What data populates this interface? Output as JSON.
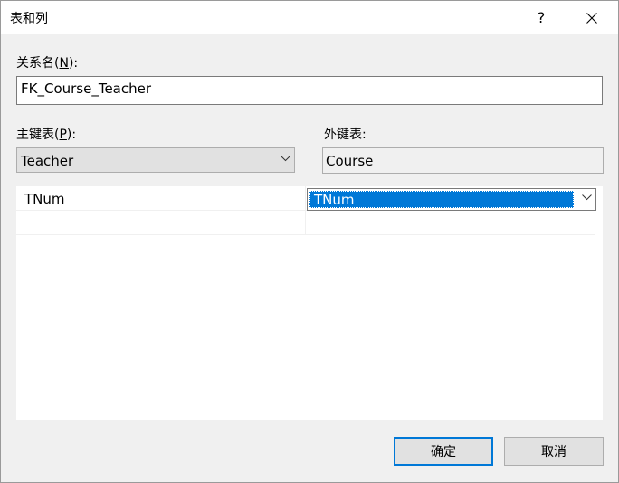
{
  "window": {
    "title": "表和列",
    "help": "?",
    "close_icon": "close-icon"
  },
  "relation_name": {
    "label_prefix": "关系名(",
    "label_key": "N",
    "label_suffix": "):",
    "value": "FK_Course_Teacher"
  },
  "primary_table": {
    "label_prefix": "主键表(",
    "label_key": "P",
    "label_suffix": "):",
    "value": "Teacher"
  },
  "foreign_table": {
    "label": "外键表:",
    "value": "Course"
  },
  "columns_grid": {
    "rows": [
      {
        "primary": "TNum",
        "foreign": "TNum"
      },
      {
        "primary": "",
        "foreign": ""
      }
    ]
  },
  "buttons": {
    "ok": "确定",
    "cancel": "取消"
  },
  "colors": {
    "accent": "#0078d7",
    "window_bg": "#f0f0f0"
  }
}
